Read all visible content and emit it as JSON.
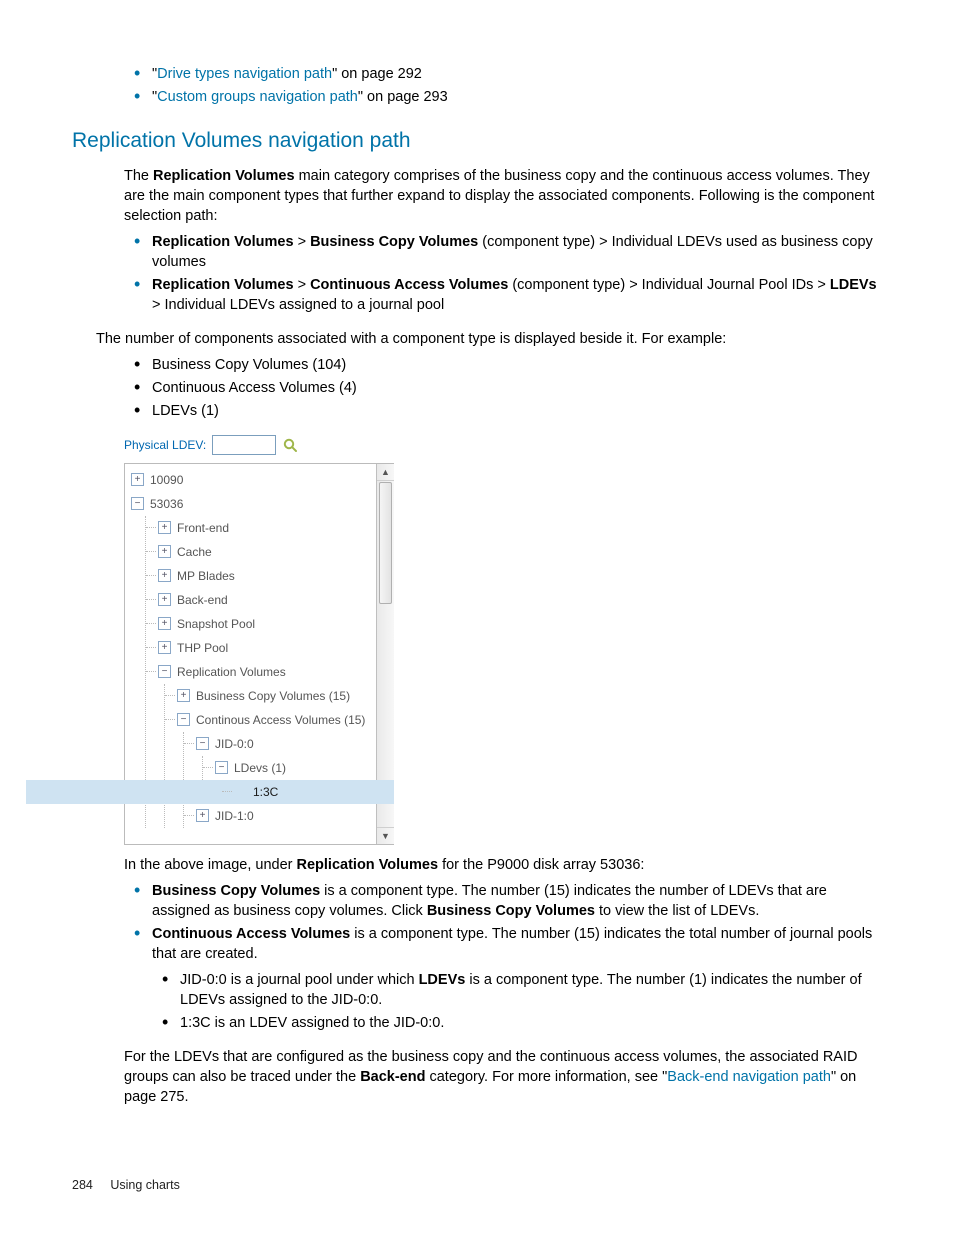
{
  "toplinks": [
    {
      "pre": "\"",
      "link": "Drive types navigation path",
      "post": "\" on page 292"
    },
    {
      "pre": "\"",
      "link": "Custom groups navigation path",
      "post": "\" on page 293"
    }
  ],
  "heading": "Replication Volumes navigation path",
  "intro": {
    "p1a": "The ",
    "p1b": "Replication Volumes",
    "p1c": " main category comprises of the business copy and the continuous access volumes. They are the main component types that further expand to display the associated components. Following is the component selection path:"
  },
  "pathlist": [
    {
      "segs": [
        "Replication Volumes",
        " > ",
        "Business Copy Volumes",
        " (component type) > Individual LDEVs used as business copy volumes"
      ]
    },
    {
      "segs": [
        "Replication Volumes",
        " > ",
        "Continuous Access Volumes",
        " (component type) > Individual Journal Pool IDs > ",
        "LDEVs",
        " > Individual LDEVs assigned to a journal pool"
      ]
    }
  ],
  "numline": "The number of components associated with a component type is displayed beside it. For example:",
  "examples": [
    "Business Copy Volumes (104)",
    "Continuous Access Volumes (4)",
    "LDEVs (1)"
  ],
  "search": {
    "label": "Physical LDEV:",
    "value": ""
  },
  "tree": {
    "n1": "10090",
    "n2": "53036",
    "c": {
      "fe": "Front-end",
      "ca": "Cache",
      "mp": "MP Blades",
      "be": "Back-end",
      "sp": "Snapshot Pool",
      "tp": "THP Pool",
      "rv": "Replication Volumes",
      "bcv": "Business Copy Volumes (15)",
      "cav": "Continous Access Volumes (15)",
      "j0": "JID-0:0",
      "ld": "LDevs (1)",
      "leaf": "1:3C",
      "j1": "JID-1:0"
    }
  },
  "belowimg": {
    "a": "In the above image, under ",
    "b": "Replication Volumes",
    "c": " for the P9000 disk array 53036:"
  },
  "desc": [
    {
      "b": "Business Copy Volumes",
      "t": " is a component type. The number (15) indicates the number of LDEVs that are assigned as business copy volumes. Click ",
      "b2": "Business Copy Volumes",
      "t2": " to view the list of LDEVs."
    },
    {
      "b": "Continuous Access Volumes",
      "t": " is a component type. The number (15) indicates the total number of journal pools that are created."
    }
  ],
  "sub": [
    {
      "a": "JID-0:0 is a journal pool under which ",
      "b": "LDEVs",
      "c": " is a component type. The number (1) indicates the number of LDEVs assigned to the JID-0:0."
    },
    {
      "a": "1:3C is an LDEV assigned to the JID-0:0."
    }
  ],
  "tail": {
    "a": "For the LDEVs that are configured as the business copy and the continuous access volumes, the associated RAID groups can also be traced under the ",
    "b": "Back-end",
    "c": " category. For more information, see \"",
    "link": "Back-end navigation path",
    "d": "\" on page 275."
  },
  "footer": {
    "page": "284",
    "chapter": "Using charts"
  }
}
